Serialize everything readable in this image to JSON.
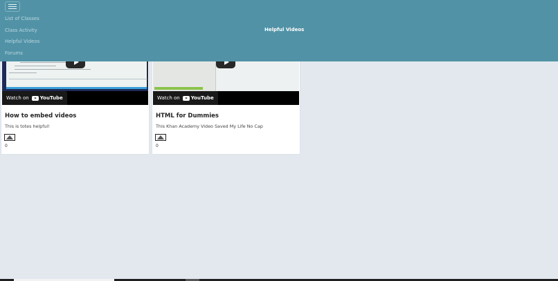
{
  "nav": {
    "items": [
      "List of Classes",
      "Class Activity",
      "Helpful Videos",
      "Forums"
    ]
  },
  "header": {
    "title": "Helpful Videos"
  },
  "videos": [
    {
      "title": "How to embed videos",
      "description": "This is totes helpful!",
      "votes": "0",
      "watch_label": "Watch on",
      "youtube_label": "YouTube"
    },
    {
      "title": "HTML for Dummies",
      "description": "This Khan Academy Video Saved My Life No Cap",
      "votes": "0",
      "watch_label": "Watch on",
      "youtube_label": "YouTube"
    }
  ],
  "colors": {
    "header_bg": "#5192a6",
    "page_bg": "#e3e8ef",
    "card_bg": "#ffffff"
  },
  "icons": {
    "menu": "hamburger-menu-icon",
    "play": "play-icon",
    "upvote": "upvote-triangle-icon"
  }
}
